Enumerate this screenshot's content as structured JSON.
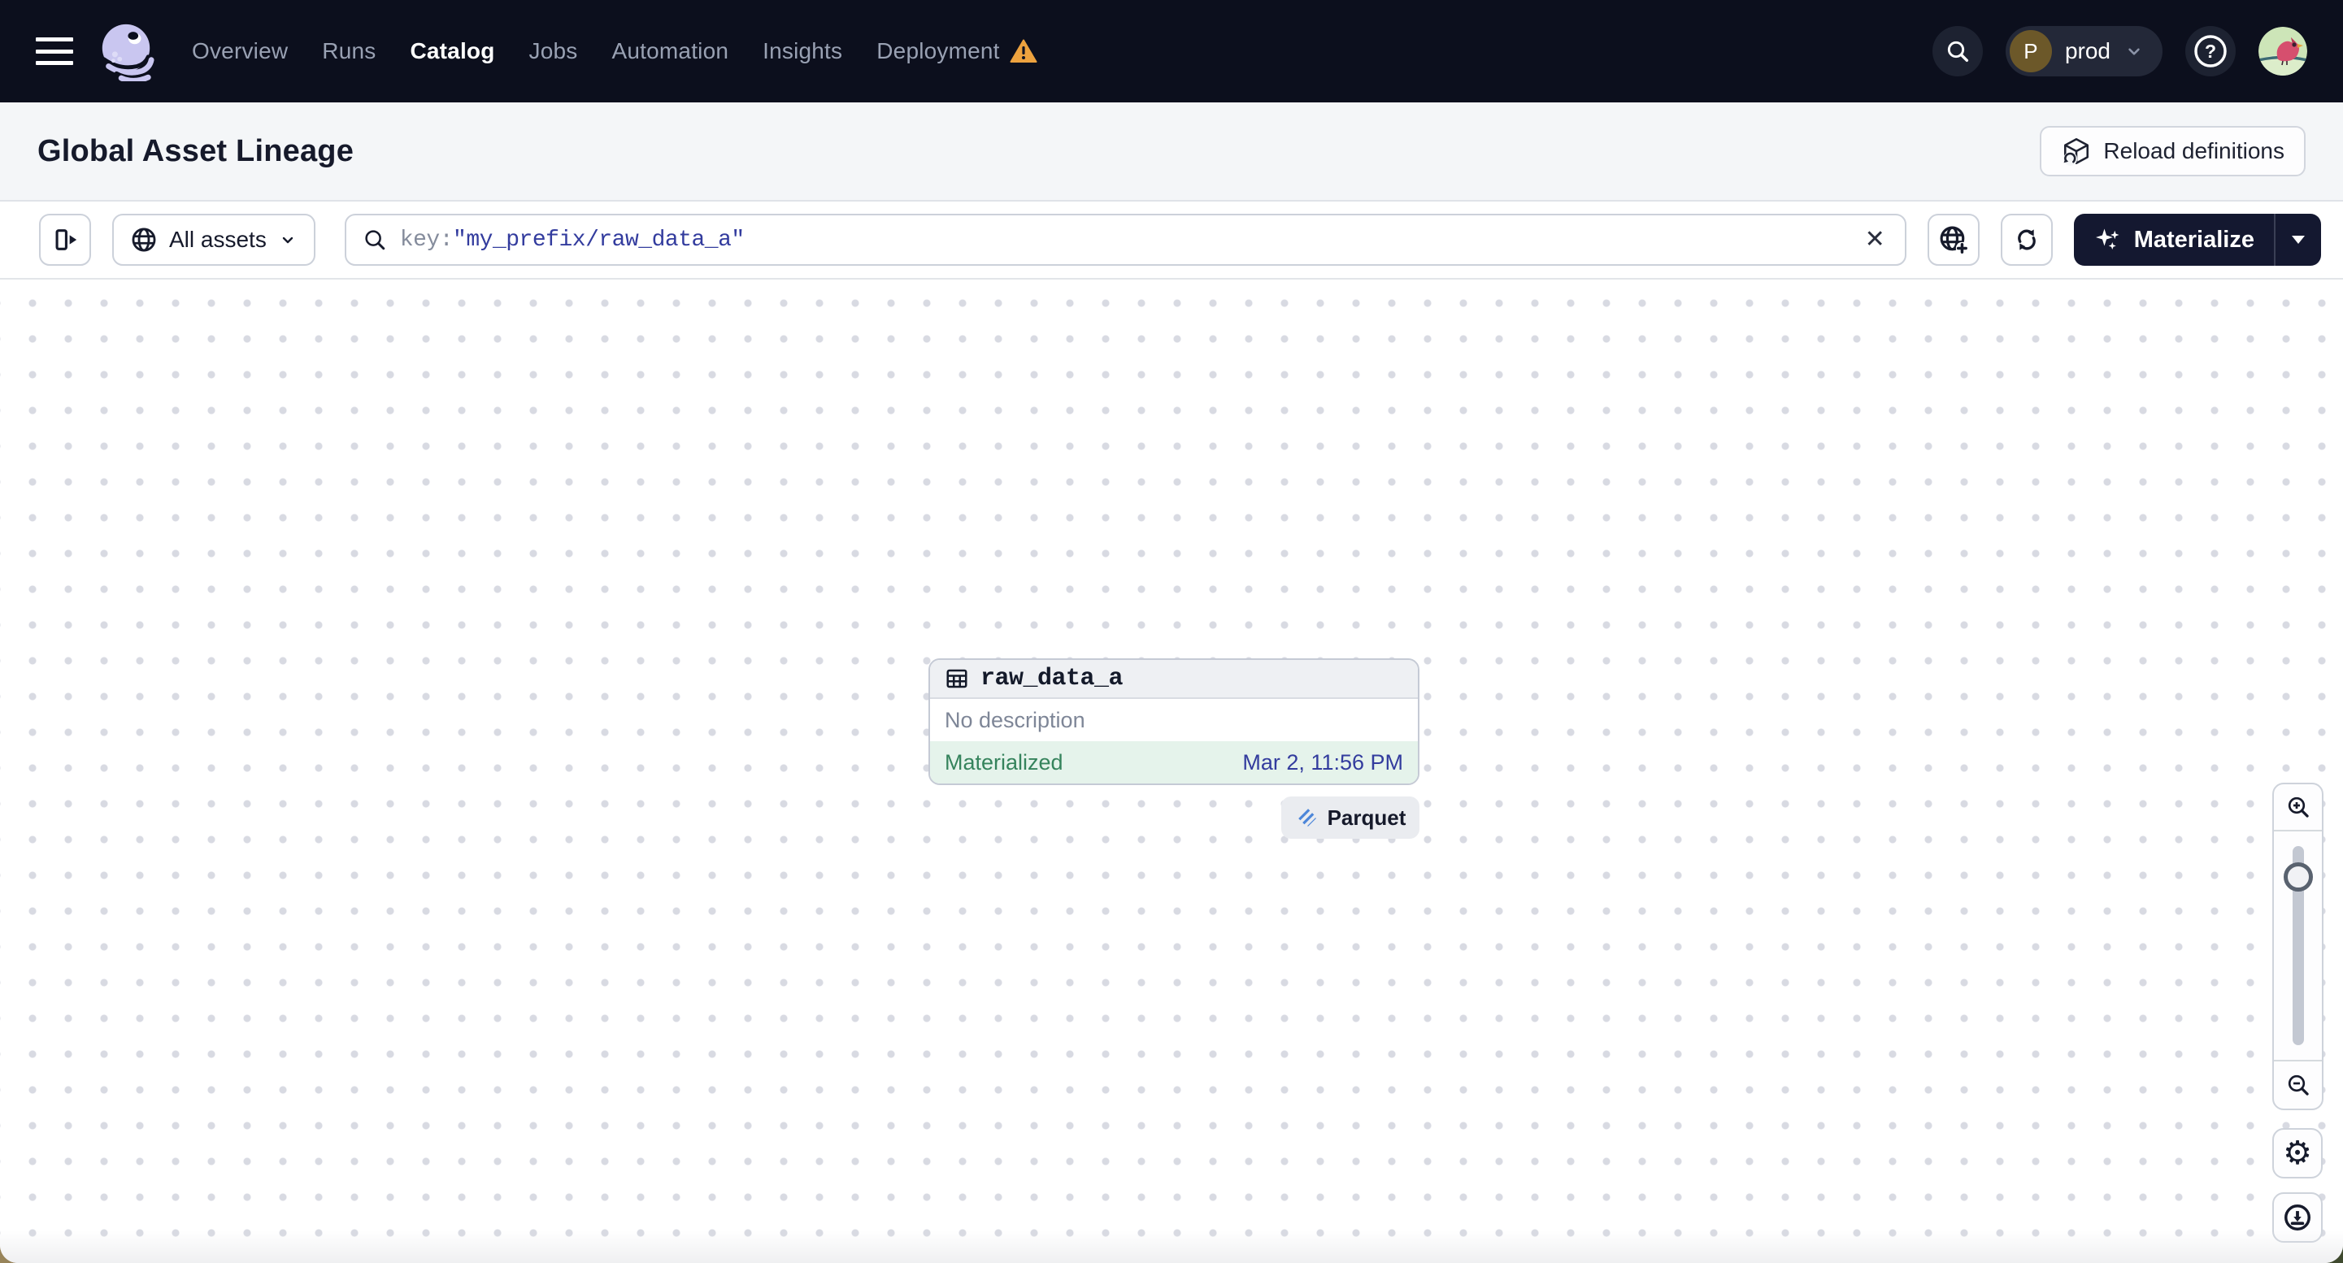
{
  "nav": {
    "items": [
      {
        "label": "Overview"
      },
      {
        "label": "Runs"
      },
      {
        "label": "Catalog",
        "active": true
      },
      {
        "label": "Jobs"
      },
      {
        "label": "Automation"
      },
      {
        "label": "Insights"
      },
      {
        "label": "Deployment",
        "warning": true
      }
    ],
    "environment": "prod",
    "environment_avatar_letter": "P"
  },
  "header": {
    "title": "Global Asset Lineage",
    "reload_label": "Reload definitions"
  },
  "toolbar": {
    "scope_label": "All assets",
    "search": {
      "prefix": "key:",
      "value": "\"my_prefix/raw_data_a\""
    },
    "materialize_label": "Materialize"
  },
  "asset_node": {
    "name": "raw_data_a",
    "description": "No description",
    "status": "Materialized",
    "timestamp": "Mar 2, 11:56 PM",
    "tag": "Parquet"
  },
  "icons": {
    "clear": "✕",
    "gear": "⚙",
    "help": "?"
  },
  "colors": {
    "nav_bg": "#0c0f1d",
    "nav_link": "#99a1b3",
    "nav_link_active": "#ffffff",
    "warning_orange": "#eda23f",
    "page_header_bg": "#f4f6f8",
    "button_border": "#ccd1da",
    "materialize_bg": "#141830",
    "query_blue": "#333c9e",
    "status_green": "#35835c",
    "status_bg_mint": "#e5f3eb",
    "muted_text": "#7e8697",
    "parquet_blue": "#4c86d9",
    "env_avatar_brown": "#6c5829",
    "logo_lavender": "#c9c6f0"
  }
}
